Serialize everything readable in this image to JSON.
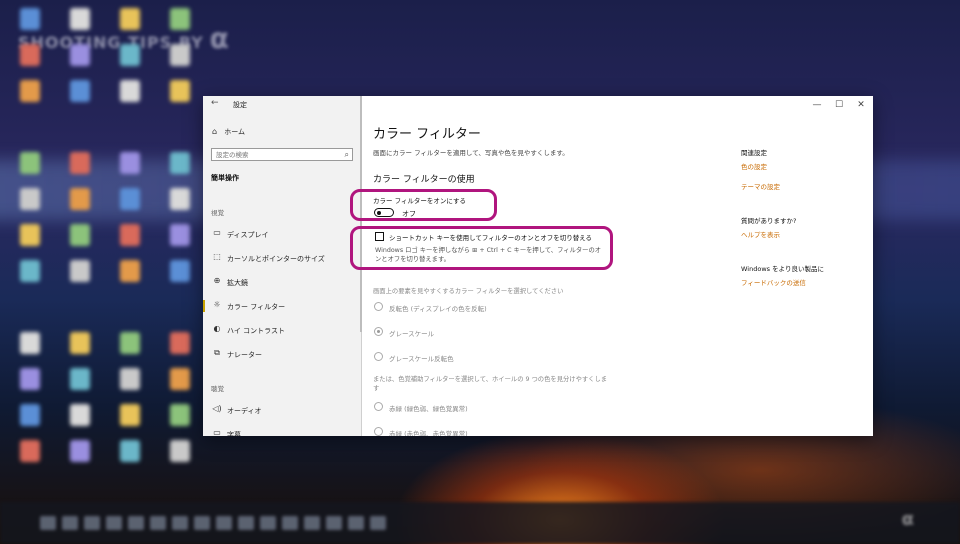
{
  "window": {
    "title": "設定",
    "back_glyph": "←",
    "minimize_glyph": "—",
    "maximize_glyph": "☐",
    "close_glyph": "✕"
  },
  "sidebar": {
    "home_label": "ホーム",
    "search_placeholder": "設定の検索",
    "category": "簡単操作",
    "groups": [
      {
        "label": "視覚"
      },
      {
        "label": "聴覚"
      }
    ],
    "items": [
      {
        "label": "ディスプレイ",
        "icon": "display-icon",
        "glyph": "▭"
      },
      {
        "label": "カーソルとポインターのサイズ",
        "icon": "cursor-icon",
        "glyph": "⬚"
      },
      {
        "label": "拡大鏡",
        "icon": "magnifier-icon",
        "glyph": "⊕"
      },
      {
        "label": "カラー フィルター",
        "icon": "color-filter-icon",
        "glyph": "☼"
      },
      {
        "label": "ハイ コントラスト",
        "icon": "high-contrast-icon",
        "glyph": "◐"
      },
      {
        "label": "ナレーター",
        "icon": "narrator-icon",
        "glyph": "⧉"
      },
      {
        "label": "オーディオ",
        "icon": "audio-icon",
        "glyph": "◁)"
      },
      {
        "label": "字幕",
        "icon": "captions-icon",
        "glyph": "▭"
      }
    ]
  },
  "main": {
    "title": "カラー フィルター",
    "description": "画面にカラー フィルターを適用して、写真や色を見やすくします。",
    "section_title": "カラー フィルターの使用",
    "toggle_label": "カラー フィルターをオンにする",
    "toggle_state": "オフ",
    "shortcut_checkbox_label": "ショートカット キーを使用してフィルターのオンとオフを切り替える",
    "shortcut_description": "Windows ロゴ キーを押しながら ⊞ + Ctrl + C キーを押して、フィルターのオンとオフを切り替えます。",
    "select_label": "画面上の要素を見やすくするカラー フィルターを選択してください",
    "filters": [
      {
        "label": "反転色 (ディスプレイの色を反転)",
        "selected": false
      },
      {
        "label": "グレースケール",
        "selected": true
      },
      {
        "label": "グレースケール反転色",
        "selected": false
      }
    ],
    "colorblind_text": "または、色覚補助フィルターを選択して、ホイールの 9 つの色を見分けやすくします",
    "colorblind_filters": [
      {
        "label": "赤緑 (緑色弱、緑色覚異常)"
      },
      {
        "label": "赤緑 (赤色弱、赤色覚異常)"
      }
    ]
  },
  "related": {
    "heading": "関連設定",
    "links": [
      "色の設定",
      "テーマの設定"
    ],
    "question_heading": "質問がありますか?",
    "help_link": "ヘルプを表示",
    "improve_heading": "Windows をより良い製品に",
    "feedback_link": "フィードバックの送信"
  },
  "desktop": {
    "watermark": "SHOOTING TIPS BY",
    "watermark_logo": "α",
    "taskbar_logo": "α"
  },
  "colors": {
    "highlight": "#b0157e",
    "link": "#c86a00",
    "accent_bar": "#c8a200"
  }
}
